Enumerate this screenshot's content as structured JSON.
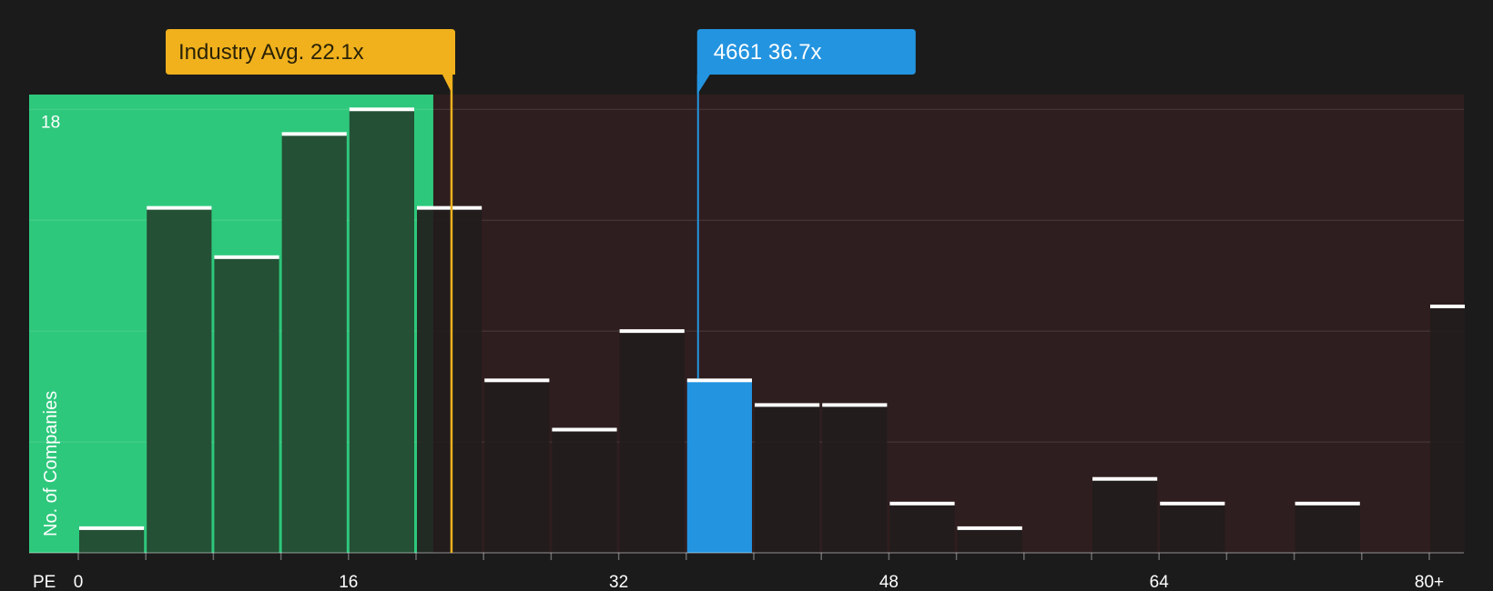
{
  "chart_data": {
    "type": "bar",
    "x_axis_label": "PE",
    "ylabel": "No. of Companies",
    "ylim": [
      0,
      18.6
    ],
    "y_tick_label": "18",
    "x_tick_labels": [
      {
        "value": 0,
        "label": "0"
      },
      {
        "value": 16,
        "label": "16"
      },
      {
        "value": 32,
        "label": "32"
      },
      {
        "value": 48,
        "label": "48"
      },
      {
        "value": 64,
        "label": "64"
      },
      {
        "value": 80,
        "label": "80+"
      }
    ],
    "bin_width": 4,
    "bins": [
      {
        "start": 0,
        "value": 1
      },
      {
        "start": 4,
        "value": 14
      },
      {
        "start": 8,
        "value": 12
      },
      {
        "start": 12,
        "value": 17
      },
      {
        "start": 16,
        "value": 18
      },
      {
        "start": 20,
        "value": 14
      },
      {
        "start": 24,
        "value": 7
      },
      {
        "start": 28,
        "value": 5
      },
      {
        "start": 32,
        "value": 9
      },
      {
        "start": 36,
        "value": 7
      },
      {
        "start": 40,
        "value": 6
      },
      {
        "start": 44,
        "value": 6
      },
      {
        "start": 48,
        "value": 2
      },
      {
        "start": 52,
        "value": 1
      },
      {
        "start": 56,
        "value": 0
      },
      {
        "start": 60,
        "value": 3
      },
      {
        "start": 64,
        "value": 2
      },
      {
        "start": 68,
        "value": 0
      },
      {
        "start": 72,
        "value": 2
      },
      {
        "start": 76,
        "value": 0
      },
      {
        "start": 80,
        "value": 10
      }
    ],
    "industry_avg": {
      "value": 22.1,
      "label": "Industry Avg. 22.1x"
    },
    "company": {
      "value": 36.7,
      "label": "4661 36.7x"
    },
    "colors": {
      "background": "#1b1b1b",
      "good_zone": "#2ec87c",
      "bad_zone": "#2f1e1f",
      "good_bar": "#24452f",
      "bad_bar": "#221c1c",
      "highlight_bar": "#2394e0",
      "industry": "#f0b11d",
      "company": "#2394e0",
      "grid": "#4a3a3a"
    }
  }
}
